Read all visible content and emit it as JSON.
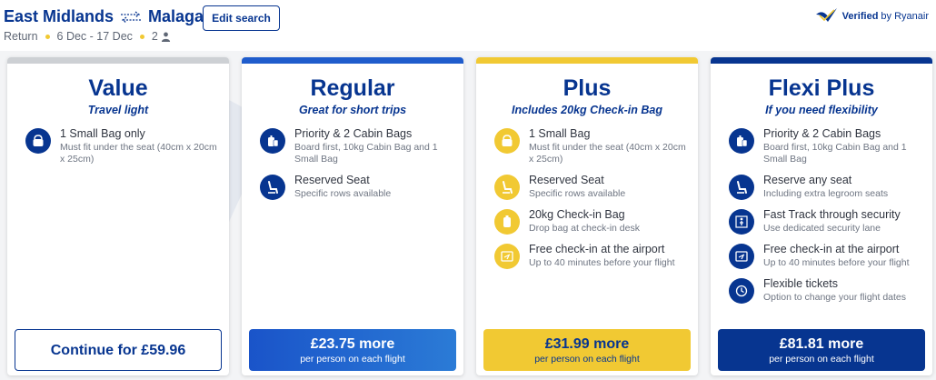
{
  "header": {
    "origin": "East Midlands",
    "destination": "Malaga",
    "trip_type": "Return",
    "dates": "6 Dec - 17 Dec",
    "passengers": "2",
    "edit_label": "Edit search",
    "verified_label": "Verified",
    "verified_by": "by Ryanair"
  },
  "colors": {
    "navy": "#073590",
    "yellow": "#f1c933",
    "blue": "#1a54c9",
    "grey_bar": "#cdd0d4"
  },
  "cards": [
    {
      "title": "Value",
      "tagline": "Travel light",
      "features": [
        {
          "icon": "small-bag-icon",
          "name": "1 Small Bag only",
          "desc": "Must fit under the seat (40cm x 20cm x 25cm)"
        }
      ],
      "cta_price": "Continue for £59.96",
      "cta_sub": ""
    },
    {
      "title": "Regular",
      "tagline": "Great for short trips",
      "features": [
        {
          "icon": "cabin-bags-icon",
          "name": "Priority & 2 Cabin Bags",
          "desc": "Board first, 10kg Cabin Bag and 1 Small Bag"
        },
        {
          "icon": "seat-icon",
          "name": "Reserved Seat",
          "desc": "Specific rows available"
        }
      ],
      "cta_price": "£23.75 more",
      "cta_sub": "per person on each flight"
    },
    {
      "title": "Plus",
      "tagline": "Includes 20kg Check-in Bag",
      "features": [
        {
          "icon": "small-bag-icon",
          "name": "1 Small Bag",
          "desc": "Must fit under the seat (40cm x 20cm x 25cm)"
        },
        {
          "icon": "seat-icon",
          "name": "Reserved Seat",
          "desc": "Specific rows available"
        },
        {
          "icon": "checkin-bag-icon",
          "name": "20kg Check-in Bag",
          "desc": "Drop bag at check-in desk"
        },
        {
          "icon": "airport-checkin-icon",
          "name": "Free check-in at the airport",
          "desc": "Up to 40 minutes before your flight"
        }
      ],
      "cta_price": "£31.99 more",
      "cta_sub": "per person on each flight"
    },
    {
      "title": "Flexi Plus",
      "tagline": "If you need flexibility",
      "features": [
        {
          "icon": "cabin-bags-icon",
          "name": "Priority & 2 Cabin Bags",
          "desc": "Board first, 10kg Cabin Bag and 1 Small Bag"
        },
        {
          "icon": "seat-icon",
          "name": "Reserve any seat",
          "desc": "Including extra legroom seats"
        },
        {
          "icon": "fast-track-icon",
          "name": "Fast Track through security",
          "desc": "Use dedicated security lane"
        },
        {
          "icon": "airport-checkin-icon",
          "name": "Free check-in at the airport",
          "desc": "Up to 40 minutes before your flight"
        },
        {
          "icon": "flexible-ticket-icon",
          "name": "Flexible tickets",
          "desc": "Option to change your flight dates"
        }
      ],
      "cta_price": "£81.81 more",
      "cta_sub": "per person on each flight"
    }
  ]
}
